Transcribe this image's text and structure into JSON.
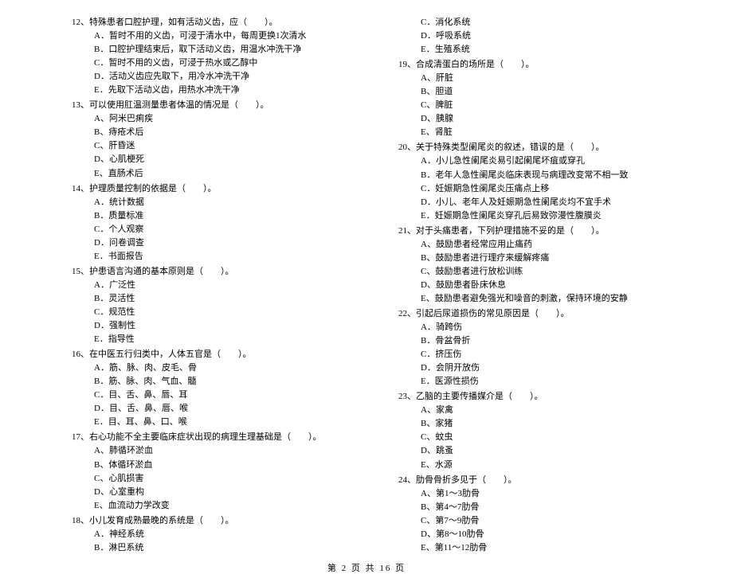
{
  "footer": "第 2 页 共 16 页",
  "left": [
    {
      "num": "12",
      "stem": "特殊患者口腔护理，如有活动义齿，应（　　）。",
      "opts": [
        "A．暂时不用的义齿，可浸于清水中，每周更换1次清水",
        "B．口腔护理结束后，取下活动义齿，用温水冲洗干净",
        "C．暂时不用的义齿，可浸于热水或乙醇中",
        "D．活动义齿应先取下，用冷水冲洗干净",
        "E．先取下活动义齿，用热水冲洗干净"
      ]
    },
    {
      "num": "13",
      "stem": "可以使用肛温测量患者体温的情况是（　　）。",
      "opts": [
        "A、阿米巴痢疾",
        "B、痔疮术后",
        "C、肝昏迷",
        "D、心肌梗死",
        "E、直肠术后"
      ]
    },
    {
      "num": "14",
      "stem": "护理质量控制的依据是（　　）。",
      "opts": [
        "A．统计数据",
        "B．质量标准",
        "C．个人观察",
        "D．问卷调查",
        "E．书面报告"
      ]
    },
    {
      "num": "15",
      "stem": "护患语言沟通的基本原则是（　　）。",
      "opts": [
        "A．广泛性",
        "B．灵活性",
        "C．规范性",
        "D．强制性",
        "E．指导性"
      ]
    },
    {
      "num": "16",
      "stem": "在中医五行归类中，人体五官是（　　）。",
      "opts": [
        "A．筋、脉、肉、皮毛、骨",
        "B．筋、脉、肉、气血、髓",
        "C．目、舌、鼻、唇、耳",
        "D．目、舌、鼻、唇、喉",
        "E．目、耳、鼻、口、喉"
      ]
    },
    {
      "num": "17",
      "stem": "右心功能不全主要临床症状出现的病理生理基础是（　　）。",
      "opts": [
        "A、肺循环淤血",
        "B、体循环淤血",
        "C、心肌损害",
        "D、心室重构",
        "E、血流动力学改变"
      ]
    },
    {
      "num": "18",
      "stem": "小儿发育成熟最晚的系统是（　　）。",
      "opts": [
        "A．神经系统",
        "B．淋巴系统"
      ]
    }
  ],
  "right_continued_opts": [
    "C．消化系统",
    "D．呼吸系统",
    "E．生殖系统"
  ],
  "right": [
    {
      "num": "19",
      "stem": "合成清蛋白的场所是（　　）。",
      "opts": [
        "A、肝脏",
        "B、胆道",
        "C、脾脏",
        "D、胰腺",
        "E、肾脏"
      ]
    },
    {
      "num": "20",
      "stem": "关于特殊类型阑尾炎的叙述，错误的是（　　）。",
      "opts": [
        "A．小儿急性阑尾炎易引起阑尾坏疽或穿孔",
        "B．老年人急性阑尾炎临床表现与病理改变常不相一致",
        "C．妊娠期急性阑尾炎压痛点上移",
        "D．小儿、老年人及妊娠期急性阑尾炎均不宜手术",
        "E．妊娠期急性阑尾炎穿孔后易致弥漫性腹膜炎"
      ]
    },
    {
      "num": "21",
      "stem": "对于头痛患者，下列护理措施不妥的是（　　）。",
      "opts": [
        "A、鼓励患者经常应用止痛药",
        "B、鼓励患者进行理疗来缓解疼痛",
        "C、鼓励患者进行放松训练",
        "D、鼓励患者卧床休息",
        "E、鼓励患者避免强光和噪音的刺激，保持环境的安静"
      ]
    },
    {
      "num": "22",
      "stem": "引起后尿道损伤的常见原因是（　　）。",
      "opts": [
        "A．骑跨伤",
        "B．骨盆骨折",
        "C．挤压伤",
        "D．会阴开放伤",
        "E．医源性损伤"
      ]
    },
    {
      "num": "23",
      "stem": "乙脑的主要传播媒介是（　　）。",
      "opts": [
        "A、家禽",
        "B、家猪",
        "C、蚊虫",
        "D、跳蚤",
        "E、水源"
      ]
    },
    {
      "num": "24",
      "stem": "肋骨骨折多见于（　　）。",
      "opts": [
        "A、第1～3肋骨",
        "B、第4～7肋骨",
        "C、第7～9肋骨",
        "D、第8～10肋骨",
        "E、第11～12肋骨"
      ]
    }
  ]
}
